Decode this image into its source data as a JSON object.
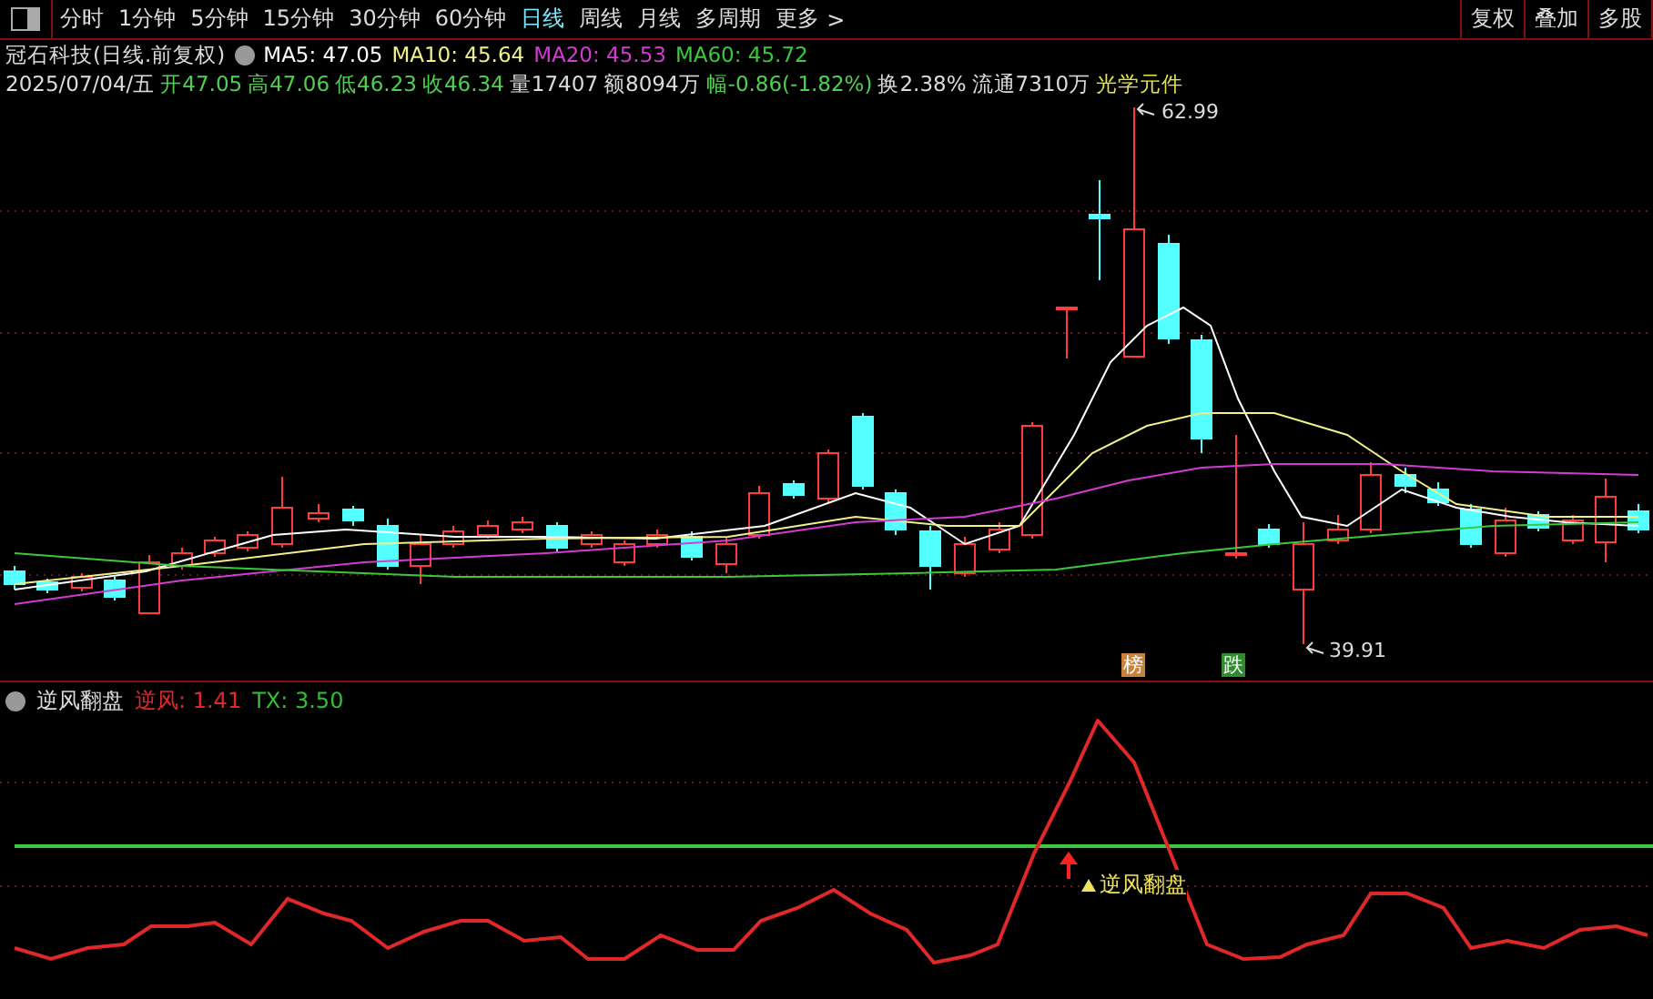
{
  "toolbar": {
    "periods": [
      {
        "label": "分时",
        "selected": false
      },
      {
        "label": "1分钟",
        "selected": false
      },
      {
        "label": "5分钟",
        "selected": false
      },
      {
        "label": "15分钟",
        "selected": false
      },
      {
        "label": "30分钟",
        "selected": false
      },
      {
        "label": "60分钟",
        "selected": false
      },
      {
        "label": "日线",
        "selected": true
      },
      {
        "label": "周线",
        "selected": false
      },
      {
        "label": "月线",
        "selected": false
      },
      {
        "label": "多周期",
        "selected": false
      }
    ],
    "more": "更多",
    "more_arrow": ">",
    "buttons": [
      "复权",
      "叠加",
      "多股"
    ]
  },
  "header": {
    "title": "冠石科技(日线.前复权)",
    "ma": [
      {
        "label": "MA5: 47.05",
        "color": "#ffffff"
      },
      {
        "label": "MA10: 45.64",
        "color": "#f0f08c"
      },
      {
        "label": "MA20: 45.53",
        "color": "#d23cd2"
      },
      {
        "label": "MA60: 45.72",
        "color": "#3cc83c"
      }
    ]
  },
  "quote": {
    "date": "2025/07/04/五",
    "items": [
      {
        "text": "开47.05",
        "color": "#50d050"
      },
      {
        "text": "高47.06",
        "color": "#50d050"
      },
      {
        "text": "低46.23",
        "color": "#50d050"
      },
      {
        "text": "收46.34",
        "color": "#50d050"
      },
      {
        "text": "量17407",
        "color": "#dcdcdc"
      },
      {
        "text": "额8094万",
        "color": "#dcdcdc"
      },
      {
        "text": "幅-0.86(-1.82%)",
        "color": "#50d050"
      },
      {
        "text": "换2.38%",
        "color": "#dcdcdc"
      },
      {
        "text": "流通7310万",
        "color": "#dcdcdc"
      },
      {
        "text": "光学元件",
        "color": "#e6e64a"
      }
    ]
  },
  "chart": {
    "high_label": "62.99",
    "low_label": "39.91",
    "signals": [
      {
        "text": "榜",
        "color": "#c8823c"
      },
      {
        "text": "跌",
        "color": "#2e8b2e"
      }
    ]
  },
  "indicator": {
    "name": "逆风翻盘",
    "values": [
      {
        "label": "逆风: 1.41",
        "color": "#e02828"
      },
      {
        "label": "TX: 3.50",
        "color": "#30c030"
      }
    ],
    "signal": "逆风翻盘"
  }
}
